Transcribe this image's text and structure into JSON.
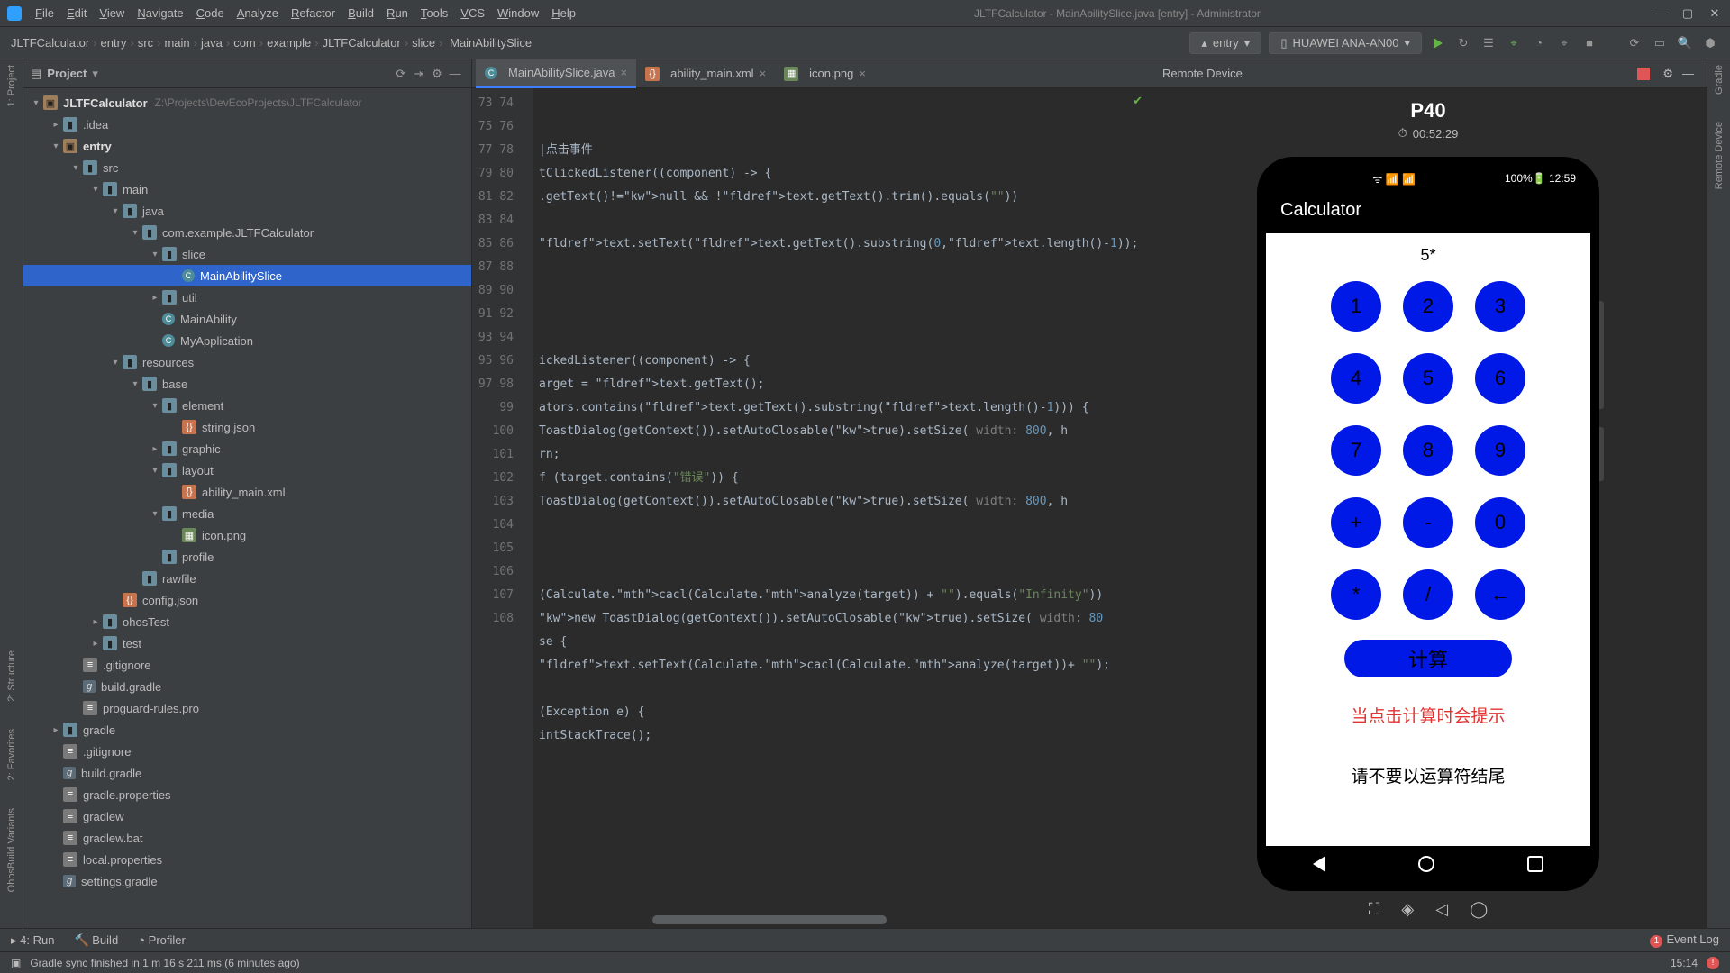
{
  "window": {
    "title": "JLTFCalculator - MainAbilitySlice.java [entry] - Administrator",
    "menu": [
      "File",
      "Edit",
      "View",
      "Navigate",
      "Code",
      "Analyze",
      "Refactor",
      "Build",
      "Run",
      "Tools",
      "VCS",
      "Window",
      "Help"
    ]
  },
  "breadcrumb": [
    "JLTFCalculator",
    "entry",
    "src",
    "main",
    "java",
    "com",
    "example",
    "JLTFCalculator",
    "slice",
    "MainAbilitySlice"
  ],
  "runconfig": {
    "module": "entry",
    "device": "HUAWEI ANA-AN00"
  },
  "sidebars": {
    "left": [
      "1: Project",
      "2: Structure",
      "2: Favorites",
      "OhosBuild Variants"
    ],
    "right": [
      "Gradle",
      "Remote Device"
    ]
  },
  "project": {
    "title": "Project",
    "root": {
      "name": "JLTFCalculator",
      "path": "Z:\\Projects\\DevEcoProjects\\JLTFCalculator"
    },
    "tree": [
      {
        "d": 1,
        "ic": "fld",
        "n": ".idea",
        "a": "r"
      },
      {
        "d": 1,
        "ic": "mod",
        "n": "entry",
        "a": "d",
        "b": true
      },
      {
        "d": 2,
        "ic": "fld",
        "n": "src",
        "a": "d"
      },
      {
        "d": 3,
        "ic": "fld",
        "n": "main",
        "a": "d"
      },
      {
        "d": 4,
        "ic": "fld",
        "n": "java",
        "a": "d"
      },
      {
        "d": 5,
        "ic": "fld",
        "n": "com.example.JLTFCalculator",
        "a": "d"
      },
      {
        "d": 6,
        "ic": "fld",
        "n": "slice",
        "a": "d"
      },
      {
        "d": 7,
        "ic": "cls",
        "n": "MainAbilitySlice",
        "sel": true
      },
      {
        "d": 6,
        "ic": "fld",
        "n": "util",
        "a": "r"
      },
      {
        "d": 6,
        "ic": "cls",
        "n": "MainAbility"
      },
      {
        "d": 6,
        "ic": "cls",
        "n": "MyApplication"
      },
      {
        "d": 4,
        "ic": "fld",
        "n": "resources",
        "a": "d"
      },
      {
        "d": 5,
        "ic": "fld",
        "n": "base",
        "a": "d"
      },
      {
        "d": 6,
        "ic": "fld",
        "n": "element",
        "a": "d"
      },
      {
        "d": 7,
        "ic": "xml",
        "n": "string.json"
      },
      {
        "d": 6,
        "ic": "fld",
        "n": "graphic",
        "a": "r"
      },
      {
        "d": 6,
        "ic": "fld",
        "n": "layout",
        "a": "d"
      },
      {
        "d": 7,
        "ic": "xml",
        "n": "ability_main.xml"
      },
      {
        "d": 6,
        "ic": "fld",
        "n": "media",
        "a": "d"
      },
      {
        "d": 7,
        "ic": "img",
        "n": "icon.png"
      },
      {
        "d": 6,
        "ic": "fld",
        "n": "profile"
      },
      {
        "d": 5,
        "ic": "fld",
        "n": "rawfile"
      },
      {
        "d": 4,
        "ic": "xml",
        "n": "config.json"
      },
      {
        "d": 3,
        "ic": "fld",
        "n": "ohosTest",
        "a": "r"
      },
      {
        "d": 3,
        "ic": "fld",
        "n": "test",
        "a": "r"
      },
      {
        "d": 2,
        "ic": "txt",
        "n": ".gitignore"
      },
      {
        "d": 2,
        "ic": "gr",
        "n": "build.gradle"
      },
      {
        "d": 2,
        "ic": "txt",
        "n": "proguard-rules.pro"
      },
      {
        "d": 1,
        "ic": "fld",
        "n": "gradle",
        "a": "r"
      },
      {
        "d": 1,
        "ic": "txt",
        "n": ".gitignore"
      },
      {
        "d": 1,
        "ic": "gr",
        "n": "build.gradle"
      },
      {
        "d": 1,
        "ic": "txt",
        "n": "gradle.properties"
      },
      {
        "d": 1,
        "ic": "txt",
        "n": "gradlew"
      },
      {
        "d": 1,
        "ic": "txt",
        "n": "gradlew.bat"
      },
      {
        "d": 1,
        "ic": "txt",
        "n": "local.properties"
      },
      {
        "d": 1,
        "ic": "gr",
        "n": "settings.gradle"
      }
    ]
  },
  "tabs": [
    {
      "name": "MainAbilitySlice.java",
      "kind": "cls",
      "active": true
    },
    {
      "name": "ability_main.xml",
      "kind": "xml"
    },
    {
      "name": "icon.png",
      "kind": "img"
    }
  ],
  "code": {
    "first_line": 73,
    "lines": [
      "",
      "",
      "|点击事件",
      "tClickedListener((component) -> {",
      ".getText()!=null && !text.getText().trim().equals(\"\"))",
      "",
      "text.setText(text.getText().substring(0,text.length()-1));",
      "",
      "",
      "",
      "",
      "ickedListener((component) -> {",
      "arget = text.getText();",
      "ators.contains(text.getText().substring(text.length()-1))) {",
      "ToastDialog(getContext()).setAutoClosable(true).setSize( width: 800, h",
      "rn;",
      "f (target.contains(\"错误\")) {",
      "ToastDialog(getContext()).setAutoClosable(true).setSize( width: 800, h",
      "",
      "",
      "",
      "(Calculate.cacl(Calculate.analyze(target)) + \"\").equals(\"Infinity\"))",
      "new ToastDialog(getContext()).setAutoClosable(true).setSize( width: 80",
      "se {",
      "text.setText(Calculate.cacl(Calculate.analyze(target))+ \"\");",
      "",
      "(Exception e) {",
      "intStackTrace();",
      "",
      "",
      "",
      "",
      "",
      "",
      "",
      ""
    ]
  },
  "device": {
    "panel_title": "Remote Device",
    "name": "P40",
    "timer": "00:52:29",
    "status_time": "12:59",
    "battery": "100%",
    "app_title": "Calculator",
    "display": "5*",
    "keys": [
      "1",
      "2",
      "3",
      "4",
      "5",
      "6",
      "7",
      "8",
      "9",
      "+",
      "-",
      "0",
      "*",
      "/",
      "←"
    ],
    "calc_btn": "计算",
    "hint_red": "当点击计算时会提示",
    "hint_blk": "请不要以运算符结尾"
  },
  "bottombar": {
    "run": "4: Run",
    "build": "Build",
    "profiler": "Profiler",
    "eventlog": "Event Log"
  },
  "status": {
    "msg": "Gradle sync finished in 1 m 16 s 211 ms (6 minutes ago)",
    "clock": "15:14"
  }
}
